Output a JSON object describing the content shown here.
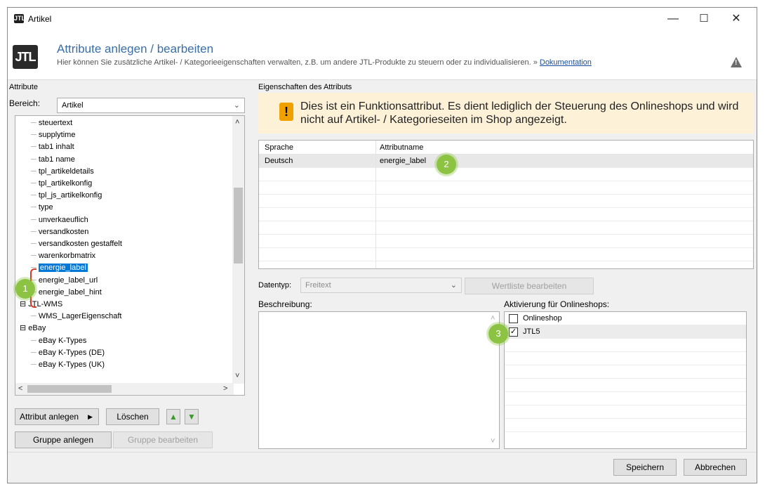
{
  "window": {
    "title": "Artikel",
    "app_icon": "JTL",
    "minimize": "—",
    "maximize": "☐",
    "close": "✕"
  },
  "header": {
    "logo": "JTL",
    "title": "Attribute anlegen / bearbeiten",
    "subtitle": "Hier können Sie zusätzliche Artikel- / Kategorieeigenschaften verwalten, z.B. um andere JTL-Produkte zu steuern oder zu individualisieren. »",
    "doc_link": "Dokumentation",
    "warn_icon": "warning-icon"
  },
  "left": {
    "group_label": "Attribute",
    "bereich_label": "Bereich:",
    "bereich_value": "Artikel",
    "tree": [
      {
        "label": "steuertext",
        "level": 2
      },
      {
        "label": "supplytime",
        "level": 2
      },
      {
        "label": "tab1 inhalt",
        "level": 2
      },
      {
        "label": "tab1 name",
        "level": 2
      },
      {
        "label": "tpl_artikeldetails",
        "level": 2
      },
      {
        "label": "tpl_artikelkonfig",
        "level": 2
      },
      {
        "label": "tpl_js_artikelkonfig",
        "level": 2
      },
      {
        "label": "type",
        "level": 2
      },
      {
        "label": "unverkaeuflich",
        "level": 2
      },
      {
        "label": "versandkosten",
        "level": 2
      },
      {
        "label": "versandkosten gestaffelt",
        "level": 2
      },
      {
        "label": "warenkorbmatrix",
        "level": 2
      },
      {
        "label": "energie_label",
        "level": 2,
        "selected": true
      },
      {
        "label": "energie_label_url",
        "level": 2
      },
      {
        "label": "energie_label_hint",
        "level": 2
      },
      {
        "label": "JTL-WMS",
        "level": 1
      },
      {
        "label": "WMS_LagerEigenschaft",
        "level": 2
      },
      {
        "label": "eBay",
        "level": 1
      },
      {
        "label": "eBay K-Types",
        "level": 2
      },
      {
        "label": "eBay K-Types (DE)",
        "level": 2
      },
      {
        "label": "eBay K-Types (UK)",
        "level": 2
      }
    ],
    "buttons": {
      "attribut_anlegen": "Attribut anlegen",
      "loeschen": "Löschen",
      "gruppe_anlegen": "Gruppe anlegen",
      "gruppe_bearbeiten": "Gruppe bearbeiten"
    },
    "badge": "1"
  },
  "right": {
    "group_label": "Eigenschaften des Attributs",
    "info_text": "Dies ist ein Funktionsattribut. Es dient lediglich der Steuerung des Onlineshops und wird nicht auf Artikel- / Kategorieseiten im Shop angezeigt.",
    "grid": {
      "col1": "Sprache",
      "col2": "Attributname",
      "rows": [
        {
          "sprache": "Deutsch",
          "attributname": "energie_label"
        }
      ]
    },
    "badge2": "2",
    "datentyp_label": "Datentyp:",
    "datentyp_value": "Freitext",
    "wertliste_button": "Wertliste bearbeiten",
    "beschreibung_label": "Beschreibung:",
    "aktivierung_label": "Aktivierung für Onlineshops:",
    "shops": [
      {
        "name": "Onlineshop",
        "checked": false
      },
      {
        "name": "JTL5",
        "checked": true
      }
    ],
    "badge3": "3"
  },
  "footer": {
    "speichern": "Speichern",
    "abbrechen": "Abbrechen"
  },
  "colors": {
    "accent": "#0078d7",
    "badge": "#8cc342",
    "info_bg": "#fdf1d8",
    "title_blue": "#3a6ea5",
    "bracket": "#d43a2a"
  }
}
